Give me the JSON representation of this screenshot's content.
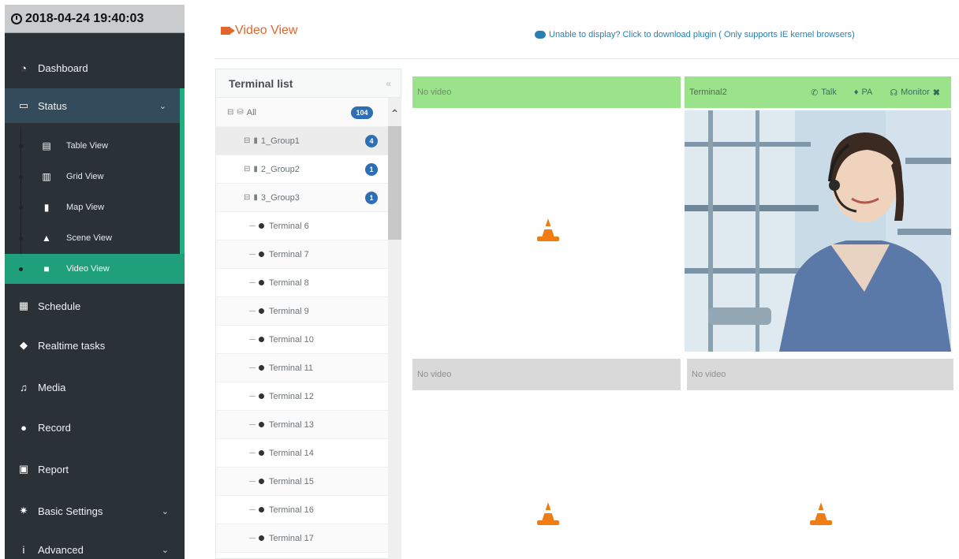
{
  "sidebar": {
    "datetime": "2018-04-24 19:40:03",
    "items": [
      {
        "label": "Dashboard",
        "icon": "tachometer-icon"
      },
      {
        "label": "Status",
        "icon": "folder-icon"
      },
      {
        "label": "Schedule",
        "icon": "calendar-icon"
      },
      {
        "label": "Realtime tasks",
        "icon": "shield-icon"
      },
      {
        "label": "Media",
        "icon": "music-icon"
      },
      {
        "label": "Record",
        "icon": "microphone-icon"
      },
      {
        "label": "Report",
        "icon": "document-icon"
      },
      {
        "label": "Basic Settings",
        "icon": "gear-icon"
      },
      {
        "label": "Advanced",
        "icon": "info-icon"
      }
    ],
    "status_sub": [
      {
        "label": "Table View",
        "icon": "table-icon"
      },
      {
        "label": "Grid View",
        "icon": "grid-icon"
      },
      {
        "label": "Map View",
        "icon": "map-icon"
      },
      {
        "label": "Scene View",
        "icon": "bell-icon"
      },
      {
        "label": "Video View",
        "icon": "video-camera-icon"
      }
    ],
    "colors": {
      "bg": "#2a3237",
      "active": "#1fa07a",
      "accent": "#1fb082"
    }
  },
  "header": {
    "title": "Video View",
    "plugin_text": "Unable to display? Click to download plugin ( Only supports IE kernel browsers)",
    "title_color": "#e1662c",
    "link_color": "#2a7fb2"
  },
  "terminal_list": {
    "title": "Terminal list",
    "collapse_glyph": "«",
    "all_label": "All",
    "all_count": "104",
    "groups": [
      {
        "label": "1_Group1",
        "count": "4"
      },
      {
        "label": "2_Group2",
        "count": "1"
      },
      {
        "label": "3_Group3",
        "count": "1"
      }
    ],
    "terminals": [
      "Terminal 6",
      "Terminal 7",
      "Terminal 8",
      "Terminal 9",
      "Terminal 10",
      "Terminal 11",
      "Terminal 12",
      "Terminal 13",
      "Terminal 14",
      "Terminal 15",
      "Terminal 16",
      "Terminal 17"
    ]
  },
  "video": {
    "pane1": {
      "status": "No video"
    },
    "pane2": {
      "terminal": "Terminal2",
      "talk": "Talk",
      "pa": "PA",
      "monitor": "Monitor",
      "close": "✖"
    },
    "pane3": {
      "status": "No video"
    },
    "pane4": {
      "status": "No video"
    }
  }
}
